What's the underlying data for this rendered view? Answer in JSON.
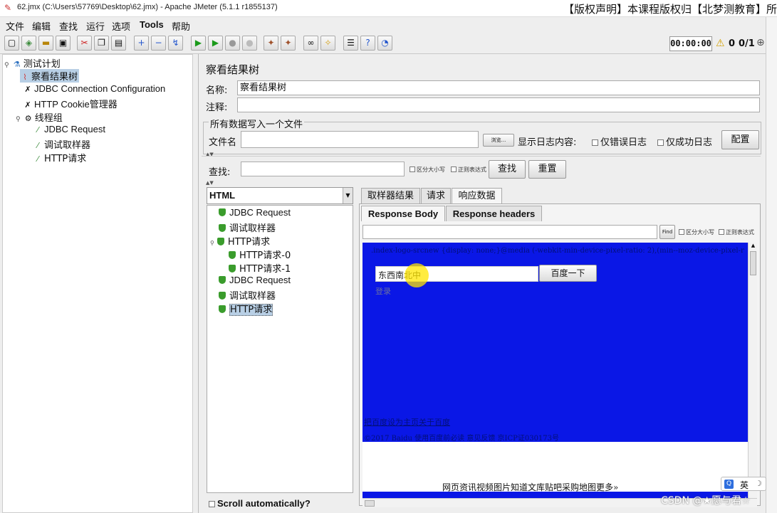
{
  "window": {
    "title": "62.jmx (C:\\Users\\57769\\Desktop\\62.jmx) - Apache JMeter (5.1.1 r1855137)",
    "copyright": "【版权声明】本课程版权归【北梦测教育】所"
  },
  "menu": [
    "文件",
    "编辑",
    "查找",
    "运行",
    "选项",
    "Tools",
    "帮助"
  ],
  "toolbar": {
    "timer": "00:00:00",
    "warnings": "0",
    "threads": "0/1"
  },
  "tree": {
    "items": [
      {
        "label": "测试计划",
        "icon": "flask-icon"
      },
      {
        "label": "察看结果树",
        "icon": "chart-icon"
      },
      {
        "label": "JDBC Connection Configuration",
        "icon": "wrench-icon"
      },
      {
        "label": "HTTP Cookie管理器",
        "icon": "wrench-icon"
      },
      {
        "label": "线程组",
        "icon": "gear-icon"
      },
      {
        "label": "JDBC Request",
        "icon": "pipette-icon"
      },
      {
        "label": "调试取样器",
        "icon": "pipette-icon"
      },
      {
        "label": "HTTP请求",
        "icon": "pipette-icon"
      }
    ]
  },
  "panel": {
    "title": "察看结果树",
    "name_label": "名称:",
    "name_value": "察看结果树",
    "comment_label": "注释:",
    "write_section": "所有数据写入一个文件",
    "filename_label": "文件名",
    "browse_button": "浏览...",
    "log_display_label": "显示日志内容:",
    "errors_only": "仅错误日志",
    "success_only": "仅成功日志",
    "configure_button": "配置",
    "search_label": "查找:",
    "case_sensitive": "区分大小写",
    "regex": "正则表达式",
    "search_button": "查找",
    "reset_button": "重置"
  },
  "results": {
    "renderer": "HTML",
    "items": [
      {
        "label": "JDBC Request",
        "indent": 0
      },
      {
        "label": "调试取样器",
        "indent": 0
      },
      {
        "label": "HTTP请求",
        "indent": 0
      },
      {
        "label": "HTTP请求-0",
        "indent": 1
      },
      {
        "label": "HTTP请求-1",
        "indent": 1
      },
      {
        "label": "JDBC Request",
        "indent": 0
      },
      {
        "label": "调试取样器",
        "indent": 0
      },
      {
        "label": "HTTP请求",
        "indent": 0
      }
    ],
    "scroll_auto": "Scroll automatically?"
  },
  "detail": {
    "tabs": [
      "取样器结果",
      "请求",
      "响应数据"
    ],
    "subtabs": [
      "Response Body",
      "Response headers"
    ],
    "find_button": "Find",
    "case_sensitive": "区分大小写",
    "regex": "正则表达式"
  },
  "html_view": {
    "css_line": ".index-logo-srcnew {display: none;}@media (-webkit-min-device-pixel-ratio: 2),(min--moz-device-pixel-r",
    "search_text": "东西南北中",
    "search_button": "百度一下",
    "login": "登录",
    "homepage_link": "把百度设为主页关于百度",
    "footer_line": "©2017 Baidu 使用百度前必读 意见反馈 京ICP证030173号",
    "nav_links": "网页资讯视频图片知道文库贴吧采购地图更多»"
  },
  "taskbar": {
    "ime_label": "英",
    "watermark": "CSDN @★愿与君☆"
  },
  "colors": {
    "html_view_bg": "#0a17e6",
    "selection": "#b8cfe5",
    "success": "#3a9c2c"
  }
}
